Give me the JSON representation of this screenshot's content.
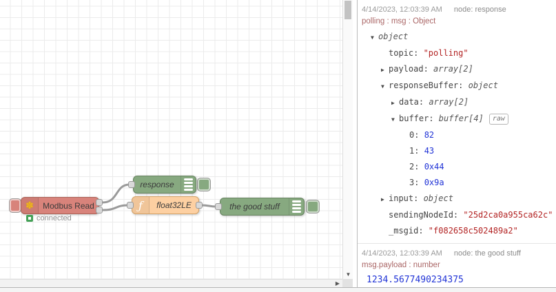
{
  "canvas": {
    "nodes": {
      "modbus_read": {
        "label": "Modbus Read",
        "status": "connected",
        "color": "#d8837b"
      },
      "response": {
        "label": "response",
        "color": "#87a980"
      },
      "float32le": {
        "label": "float32LE",
        "color": "#fdd0a2"
      },
      "good_stuff": {
        "label": "the good stuff",
        "color": "#87a980"
      }
    }
  },
  "icons": {
    "modbus": "✽",
    "function": "ƒ",
    "scroll_down": "▼",
    "scroll_right": "▶"
  },
  "debug": {
    "messages": [
      {
        "timestamp": "4/14/2023, 12:03:39 AM",
        "source": "node: response",
        "meta": "polling : msg : Object",
        "rows": [
          {
            "indent": 0,
            "arrow": "▼",
            "key": "",
            "value": "object",
            "vtype": "type"
          },
          {
            "indent": 1,
            "arrow": "",
            "key": "topic",
            "value": "\"polling\"",
            "vtype": "string"
          },
          {
            "indent": 1,
            "arrow": "▶",
            "key": "payload",
            "value": "array[2]",
            "vtype": "type"
          },
          {
            "indent": 1,
            "arrow": "▼",
            "key": "responseBuffer",
            "value": "object",
            "vtype": "type"
          },
          {
            "indent": 2,
            "arrow": "▶",
            "key": "data",
            "value": "array[2]",
            "vtype": "type"
          },
          {
            "indent": 2,
            "arrow": "▼",
            "key": "buffer",
            "value": "buffer[4]",
            "vtype": "type",
            "badge": "raw"
          },
          {
            "indent": 3,
            "arrow": "",
            "key": "0",
            "value": "82",
            "vtype": "number"
          },
          {
            "indent": 3,
            "arrow": "",
            "key": "1",
            "value": "43",
            "vtype": "number"
          },
          {
            "indent": 3,
            "arrow": "",
            "key": "2",
            "value": "0x44",
            "vtype": "number"
          },
          {
            "indent": 3,
            "arrow": "",
            "key": "3",
            "value": "0x9a",
            "vtype": "number"
          },
          {
            "indent": 1,
            "arrow": "▶",
            "key": "input",
            "value": "object",
            "vtype": "type"
          },
          {
            "indent": 1,
            "arrow": "",
            "key": "sendingNodeId",
            "value": "\"25d2ca0a955ca62c\"",
            "vtype": "string"
          },
          {
            "indent": 1,
            "arrow": "",
            "key": "_msgid",
            "value": "\"f082658c502489a2\"",
            "vtype": "string"
          }
        ]
      },
      {
        "timestamp": "4/14/2023, 12:03:39 AM",
        "source": "node: the good stuff",
        "meta": "msg.payload : number",
        "payload": "1234.5677490234375"
      }
    ]
  }
}
